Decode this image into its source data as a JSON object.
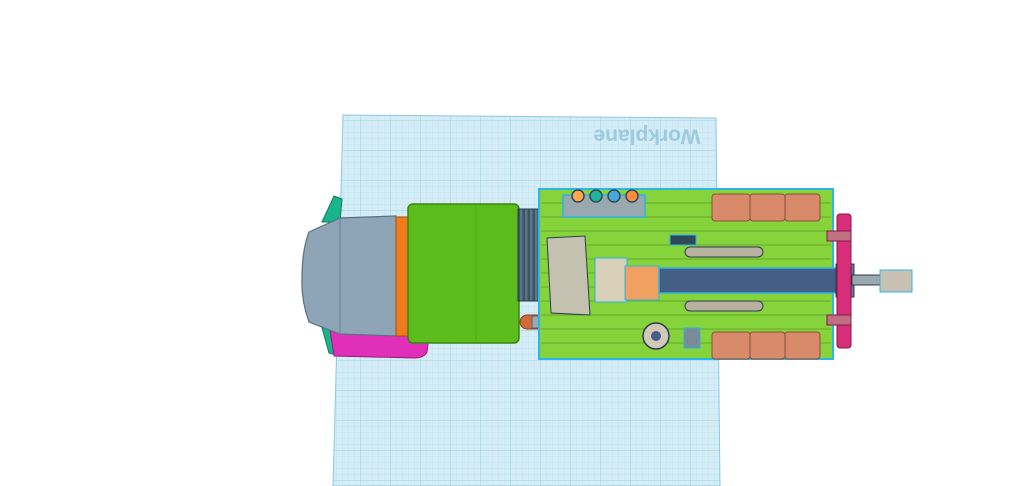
{
  "workplane": {
    "label": "Workplane",
    "fill_color": "#d4edf6",
    "grid_minor_color": "#b3dcec",
    "grid_major_color": "#8cc8e0"
  },
  "selection_outline_color": "#2bb5e8",
  "model": {
    "icon": "3d-model-assembly",
    "parts": [
      {
        "name": "cab-hood",
        "color": "#8ea5b8"
      },
      {
        "name": "cab-divider",
        "color": "#f07b1c"
      },
      {
        "name": "cab-body",
        "color": "#5cbc1c"
      },
      {
        "name": "radiator",
        "color": "#3b5566"
      },
      {
        "name": "fender",
        "color": "#e02fb8"
      },
      {
        "name": "side-fin",
        "color": "#18b48a"
      },
      {
        "name": "flatbed",
        "color": "#86d43c"
      },
      {
        "name": "crane-boom",
        "color": "#445e86"
      },
      {
        "name": "cargo-crates",
        "color": "#d88a6a"
      },
      {
        "name": "rear-bar",
        "color": "#d82e7a"
      },
      {
        "name": "hydraulic-cylinders",
        "color": "#b8b0a0"
      }
    ],
    "gauge_colors": [
      "#ffa64a",
      "#22b49a",
      "#4aa8d8",
      "#ff8a3a"
    ]
  }
}
